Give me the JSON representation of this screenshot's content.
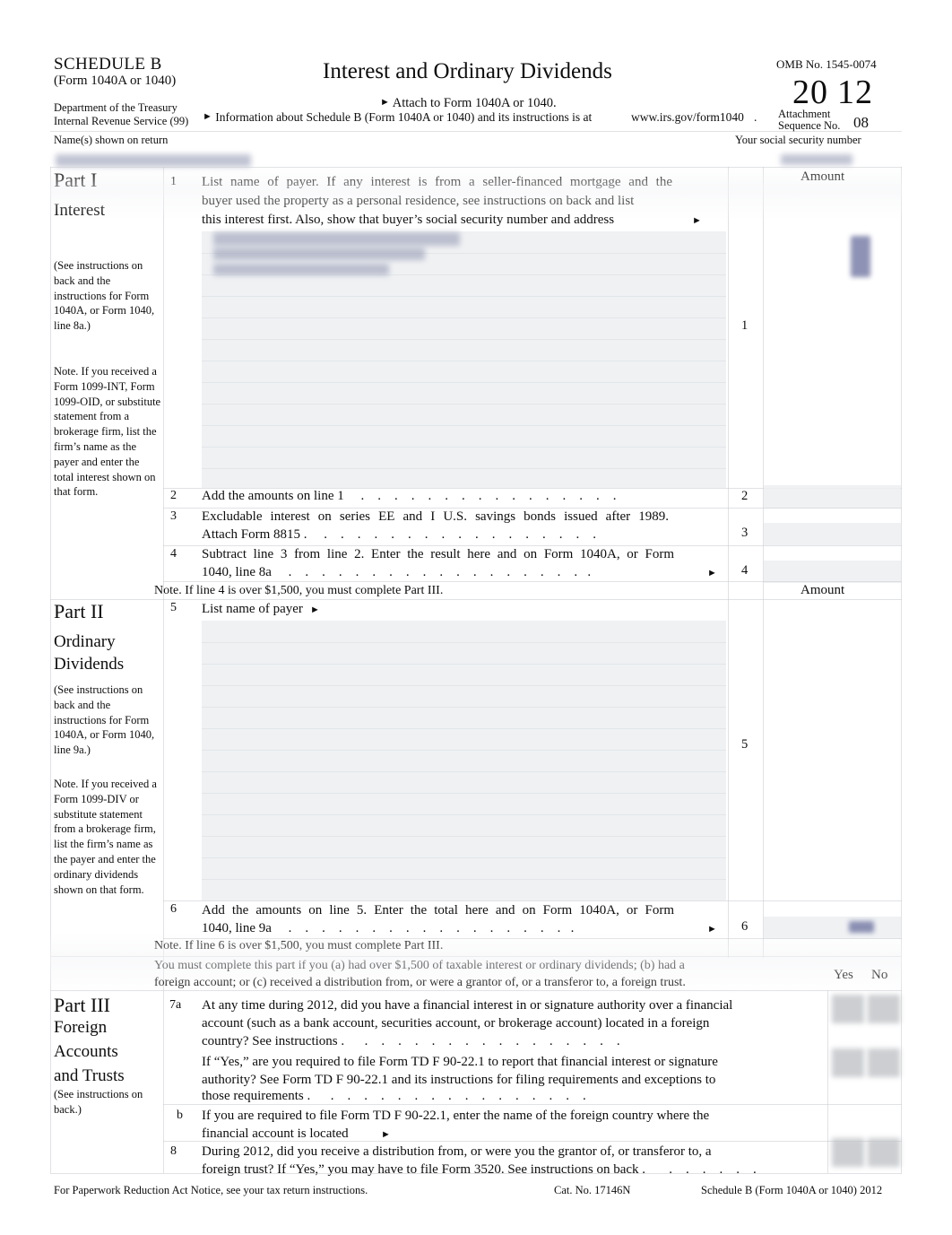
{
  "form": {
    "schedule_title": "SCHEDULE B",
    "schedule_subtitle": "(Form 1040A or 1040)",
    "department_line1": "Department of the Treasury",
    "department_line2": "Internal Revenue Service (99)",
    "title": "Interest and Ordinary Dividends",
    "attach_line": "Attach to Form 1040A or 1040.",
    "info_line": "Information about Schedule B (Form 1040A or 1040) and its instructions is at",
    "info_url": "www.irs.gov/form1040",
    "info_period": ".",
    "omb": "OMB No. 1545-0074",
    "year_left": "20",
    "year_right": "12",
    "attachment_label_line1": "Attachment",
    "attachment_label_line2": "Sequence No.",
    "attachment_seq": "08",
    "name_field_label": "Name(s) shown on return",
    "ssn_field_label": "Your social security number"
  },
  "part1": {
    "part_label": "Part I",
    "part_name": "Interest",
    "instructions": "(See instructions on back and the instructions for Form 1040A, or Form 1040, line 8a.)",
    "note": "Note.   If you received a Form 1099-INT, Form 1099-OID, or substitute statement from a brokerage firm, list the firm’s name as the payer and enter the total interest shown on that form.",
    "amount_header": "Amount",
    "lines": [
      {
        "no": "1",
        "text_line1": "List  name  of  payer.  If  any  interest  is  from  a  seller-financed  mortgage  and  the",
        "text_line2": "buyer used the property as a personal residence, see instructions on back and list",
        "text_line3": "this interest first. Also, show that buyer’s social security number and address",
        "col_num": "1",
        "has_arrow": true
      },
      {
        "no": "2",
        "text_line1": "Add the amounts on line 1",
        "col_num": "2",
        "has_arrow": false
      },
      {
        "no": "3",
        "text_line1": "Excludable  interest  on  series  EE  and  I  U.S.  savings  bonds  issued  after  1989.",
        "text_line2": "Attach Form 8815 .",
        "col_num": "3",
        "has_arrow": false
      },
      {
        "no": "4",
        "text_line1": "Subtract  line  3  from  line  2.  Enter  the  result  here  and  on  Form  1040A,  or  Form",
        "text_line2": "1040, line 8a",
        "col_num": "4",
        "has_arrow": true
      }
    ],
    "note_after": "Note.   If line 4 is over $1,500, you must complete Part III."
  },
  "part2": {
    "part_label": "Part II",
    "part_name_line1": "Ordinary",
    "part_name_line2": "Dividends",
    "instructions": "(See instructions on back and the instructions for Form 1040A, or Form 1040, line 9a.)",
    "note": "Note.  If you received a Form 1099-DIV or substitute statement from a brokerage firm, list the firm’s name as the payer and enter the ordinary dividends shown on that form.",
    "amount_header": "Amount",
    "lines": [
      {
        "no": "5",
        "text_line1": "List name of payer",
        "col_num": "5",
        "has_arrow": true
      },
      {
        "no": "6",
        "text_line1": "Add  the  amounts  on  line  5.  Enter  the  total  here  and  on  Form  1040A,  or  Form",
        "text_line2": "1040, line 9a",
        "col_num": "6",
        "has_arrow": true
      }
    ],
    "note_after": "Note.   If line 6 is over $1,500, you must complete Part III."
  },
  "part3": {
    "part_label": "Part III",
    "part_name_line1": "Foreign",
    "part_name_line2": "Accounts",
    "part_name_line3": "and Trusts",
    "instructions": "(See instructions on back.)",
    "intro_line1": "You must complete this part if you      (a) had over $1,500 of taxable interest or ordinary dividends;         (b) had a",
    "intro_line2": "foreign account; or    (c) received a distribution from, or were a grantor of, or a transferor to, a foreign trust.",
    "yes_label": "Yes",
    "no_label": "No",
    "lines": [
      {
        "no": "7a",
        "text_line1": "At any time during 2012, did you have a financial interest in or signature authority over a financial",
        "text_line2": "account (such as a bank account, securities account, or brokerage account) located in a foreign",
        "text_line3": "country?  See  instructions  ."
      },
      {
        "no": "",
        "text_line1": "If “Yes,” are you    required to file Form TD F 90-22.1 to report that financial interest or signature",
        "text_line2": "authority? See Form TD F 90-22.1 and its instructions for filing requirements and exceptions to",
        "text_line3": "those  requirements  ."
      },
      {
        "no": "b",
        "text_line1": "If you are required to file Form TD F 90-22.1, enter the name of the foreign country where the",
        "text_line2": "financial account is located",
        "has_arrow": true
      },
      {
        "no": "8",
        "text_line1": "During 2012, did you receive a distribution from, or were you the grantor of, or transferor to, a",
        "text_line2": "foreign trust? If “Yes,” you may have to file Form 3520. See instructions on back ."
      }
    ]
  },
  "footer": {
    "paperwork": "For Paperwork Reduction Act Notice, see your tax return instructions.",
    "cat_no": "Cat. No. 17146N",
    "form_ref": "Schedule B (Form 1040A or 1040) 2012"
  }
}
